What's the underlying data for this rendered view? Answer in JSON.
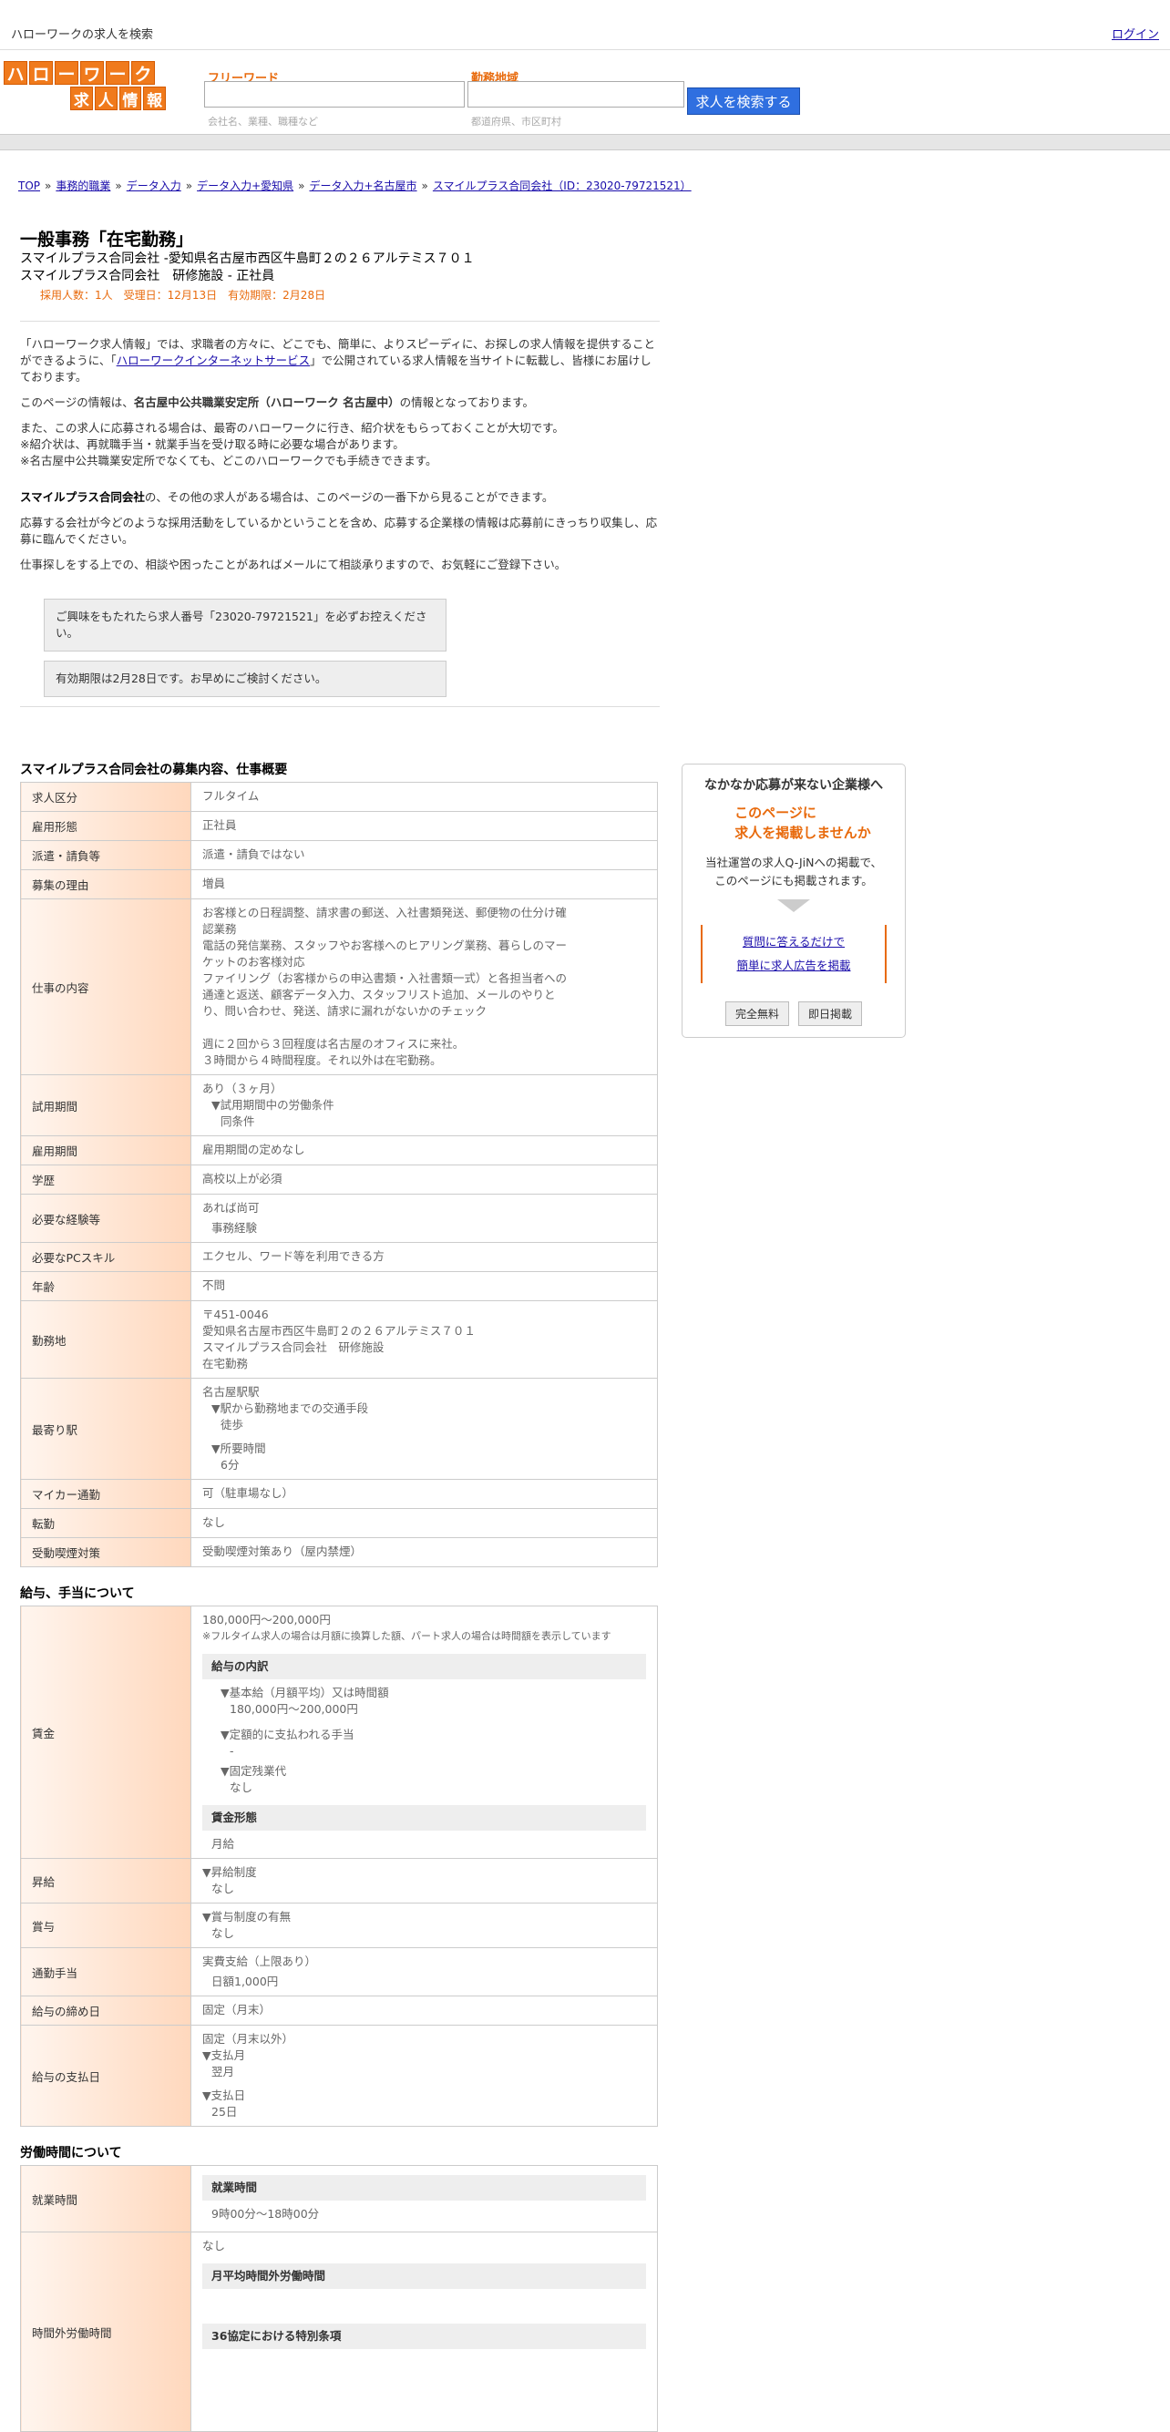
{
  "topbar": {
    "tagline": "ハローワークの求人を検索",
    "login": "ログイン"
  },
  "logo": {
    "row1": [
      "ハ",
      "ロ",
      "ー",
      "ワ",
      "ー",
      "ク"
    ],
    "row2": [
      "求",
      "人",
      "情",
      "報"
    ]
  },
  "search": {
    "keyword_label": "フリーワード",
    "keyword_hint": "会社名、業種、職種など",
    "area_label": "勤務地域",
    "area_hint": "都道府県、市区町村",
    "button": "求人を検索する"
  },
  "breadcrumb": [
    "TOP",
    "事務的職業",
    "データ入力",
    "データ入力+愛知県",
    "データ入力+名古屋市",
    "スマイルプラス合同会社（ID：23020-79721521）"
  ],
  "job": {
    "title": "一般事務「在宅勤務」",
    "company_line": "スマイルプラス合同会社 -愛知県名古屋市西区牛島町２の２６アルテミス７０１",
    "branch_line": "スマイルプラス合同会社　研修施設 - 正社員",
    "meta": "採用人数：1人　受理日：12月13日　有効期限：2月28日"
  },
  "intro": {
    "p1_a": "「ハローワーク求人情報」では、求職者の方々に、どこでも、簡単に、よりスピーディに、お探しの求人情報を提供することができるように、「",
    "p1_link": "ハローワークインターネットサービス",
    "p1_b": "」で公開されている求人情報を当サイトに転載し、皆様にお届けしております。",
    "p2_a": "このページの情報は、",
    "p2_bold": "名古屋中公共職業安定所（ハローワーク 名古屋中）",
    "p2_b": "の情報となっております。",
    "p3_1": "また、この求人に応募される場合は、最寄のハローワークに行き、紹介状をもらっておくことが大切です。",
    "p3_2": "※紹介状は、再就職手当・就業手当を受け取る時に必要な場合があります。",
    "p3_3": "※名古屋中公共職業安定所でなくても、どこのハローワークでも手続きできます。",
    "p4_bold": "スマイルプラス合同会社",
    "p4_b": "の、その他の求人がある場合は、このページの一番下から見ることができます。",
    "p5": "応募する会社が今どのような採用活動をしているかということを含め、応募する企業様の情報は応募前にきっちり収集し、応募に臨んでください。",
    "p6": "仕事探しをする上での、相談や困ったことがあればメールにて相談承りますので、お気軽にご登録下さい。",
    "note1": "ご興味をもたれたら求人番号「23020-79721521」を必ずお控えください。",
    "note2": "有効期限は2月28日です。お早めにご検討ください。"
  },
  "overview": {
    "title": "スマイルプラス合同会社の募集内容、仕事概要",
    "rows": {
      "kubun": {
        "h": "求人区分",
        "v": "フルタイム"
      },
      "keitai": {
        "h": "雇用形態",
        "v": "正社員"
      },
      "haken": {
        "h": "派遣・請負等",
        "v": "派遣・請負ではない"
      },
      "riyu": {
        "h": "募集の理由",
        "v": "増員"
      },
      "naiyo": {
        "h": "仕事の内容",
        "v": [
          "お客様との日程調整、請求書の郵送、入社書類発送、郵便物の仕分け確認業務",
          "電話の発信業務、スタッフやお客様へのヒアリング業務、暮らしのマーケットのお客様対応",
          "ファイリング（お客様からの申込書類・入社書類一式）と各担当者への通達と返送、顧客データ入力、スタッフリスト追加、メールのやりとり、問い合わせ、発送、請求に漏れがないかのチェック",
          "",
          "週に２回から３回程度は名古屋のオフィスに来社。",
          "３時間から４時間程度。それ以外は在宅勤務。"
        ]
      },
      "shiyo": {
        "h": "試用期間",
        "v1": "あり（３ヶ月）",
        "v2": "▼試用期間中の労働条件",
        "v3": "同条件"
      },
      "kikan": {
        "h": "雇用期間",
        "v": "雇用期間の定めなし"
      },
      "gakureki": {
        "h": "学歴",
        "v": "高校以上が必須"
      },
      "keiken": {
        "h": "必要な経験等",
        "v1": "あれば尚可",
        "v2": "事務経験"
      },
      "pc": {
        "h": "必要なPCスキル",
        "v": "エクセル、ワード等を利用できる方"
      },
      "nenrei": {
        "h": "年齢",
        "v": "不問"
      },
      "kinmuchi": {
        "h": "勤務地",
        "v": [
          "〒451-0046",
          "愛知県名古屋市西区牛島町２の２６アルテミス７０１",
          "スマイルプラス合同会社　研修施設",
          "在宅勤務"
        ]
      },
      "eki": {
        "h": "最寄り駅",
        "v1": "名古屋駅駅",
        "v2": "▼駅から勤務地までの交通手段",
        "v3": "徒歩",
        "v4": "▼所要時間",
        "v5": "6分"
      },
      "mycar": {
        "h": "マイカー通勤",
        "v": "可（駐車場なし）"
      },
      "tenkin": {
        "h": "転勤",
        "v": "なし"
      },
      "kitsuen": {
        "h": "受動喫煙対策",
        "v": "受動喫煙対策あり（屋内禁煙）"
      }
    }
  },
  "salary": {
    "title": "給与、手当について",
    "chingin": {
      "h": "賃金",
      "range": "180,000円〜200,000円",
      "note": "※フルタイム求人の場合は月額に換算した額、パート求人の場合は時間額を表示しています",
      "sub1": "給与の内訳",
      "a1": "▼基本給（月額平均）又は時間額",
      "a2": "180,000円〜200,000円",
      "a3": "▼定額的に支払われる手当",
      "a4": "-",
      "a5": "▼固定残業代",
      "a6": "なし",
      "sub2": "賃金形態",
      "b1": "月給"
    },
    "shokyu": {
      "h": "昇給",
      "v1": "▼昇給制度",
      "v2": "なし"
    },
    "shoyo": {
      "h": "賞与",
      "v1": "▼賞与制度の有無",
      "v2": "なし"
    },
    "tsukin": {
      "h": "通勤手当",
      "v1": "実費支給（上限あり）",
      "v2": "日額1,000円"
    },
    "shime": {
      "h": "給与の締め日",
      "v": "固定（月末）"
    },
    "shiharai": {
      "h": "給与の支払日",
      "v1": "固定（月末以外）",
      "v2": "▼支払月",
      "v3": "翌月",
      "v4": "▼支払日",
      "v5": "25日"
    }
  },
  "hours": {
    "title": "労働時間について",
    "shugyo": {
      "h": "就業時間",
      "sub": "就業時間",
      "v": "9時00分〜18時00分"
    },
    "jikangai": {
      "h": "時間外労働時間",
      "v": "なし",
      "sub1": "月平均時間外労働時間",
      "sub2": "36協定における特別条項"
    }
  },
  "side": {
    "heading": "なかなか応募が来ない企業様へ",
    "orange1": "このページに",
    "orange2": "求人を掲載しませんか",
    "text1": "当社運営の求人Q-JiNへの掲載で、",
    "text2": "このページにも掲載されます。",
    "link1": "質問に答えるだけで",
    "link2": "簡単に求人広告を掲載",
    "btn1": "完全無料",
    "btn2": "即日掲載"
  }
}
